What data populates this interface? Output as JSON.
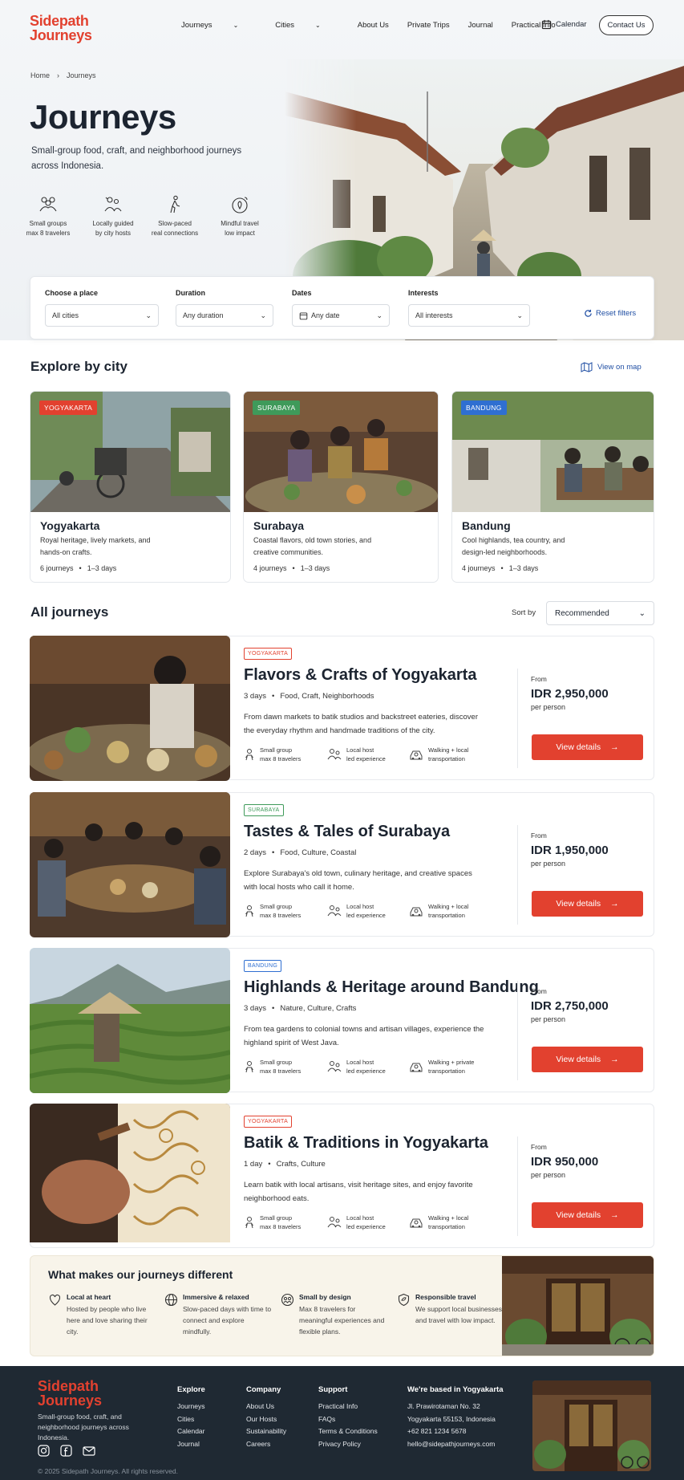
{
  "brand": {
    "name_line1": "Sidepath",
    "name_line2": "Journeys"
  },
  "nav": {
    "items": [
      {
        "label": "Journeys",
        "has_menu": true
      },
      {
        "label": "Cities",
        "has_menu": true
      },
      {
        "label": "About Us",
        "has_menu": false
      },
      {
        "label": "Private Trips",
        "has_menu": false
      },
      {
        "label": "Journal",
        "has_menu": false
      },
      {
        "label": "Practical Info",
        "has_menu": false
      }
    ],
    "calendar_label": "Calendar",
    "contact_label": "Contact Us"
  },
  "breadcrumb": {
    "home": "Home",
    "current": "Journeys"
  },
  "hero": {
    "title": "Journeys",
    "subtitle": "Small-group food, craft, and neighborhood journeys across Indonesia.",
    "features": [
      {
        "icon": "group-icon",
        "line1": "Small groups",
        "line2": "max 8 travelers"
      },
      {
        "icon": "guide-icon",
        "line1": "Locally guided",
        "line2": "by city hosts"
      },
      {
        "icon": "walker-icon",
        "line1": "Slow-paced",
        "line2": "real connections"
      },
      {
        "icon": "globe-leaf-icon",
        "line1": "Mindful travel",
        "line2": "low impact"
      }
    ]
  },
  "filters": {
    "place": {
      "label": "Choose a place",
      "value": "All cities"
    },
    "duration": {
      "label": "Duration",
      "value": "Any duration"
    },
    "dates": {
      "label": "Dates",
      "value": "Any date"
    },
    "interests": {
      "label": "Interests",
      "value": "All interests"
    },
    "reset_label": "Reset filters"
  },
  "explore": {
    "title": "Explore by city",
    "map_link": "View on map",
    "cities": [
      {
        "badge": "YOGYAKARTA",
        "badge_color": "#e2412f",
        "name": "Yogyakarta",
        "desc": "Royal heritage, lively markets, and hands-on crafts.",
        "journeys": "6 journeys",
        "days": "1–3 days"
      },
      {
        "badge": "SURABAYA",
        "badge_color": "#3f9a5a",
        "name": "Surabaya",
        "desc": "Coastal flavors, old town stories, and creative communities.",
        "journeys": "4 journeys",
        "days": "1–3 days"
      },
      {
        "badge": "BANDUNG",
        "badge_color": "#2f6fd1",
        "name": "Bandung",
        "desc": "Cool highlands, tea country, and design-led neighborhoods.",
        "journeys": "4 journeys",
        "days": "1–3 days"
      }
    ]
  },
  "all_journeys": {
    "title": "All journeys",
    "sort_label": "Sort by",
    "sort_value": "Recommended",
    "from_label": "From",
    "per_person": "per person",
    "button_label": "View details",
    "items": [
      {
        "tag": "YOGYAKARTA",
        "tag_color": "#e2412f",
        "title": "Flavors & Crafts of Yogyakarta",
        "days": "3 days",
        "themes": "Food, Craft, Neighborhoods",
        "desc": "From dawn markets to batik studios and backstreet eateries, discover the everyday rhythm and handmade traditions of the city.",
        "price": "IDR 2,950,000",
        "features": [
          [
            "Small group",
            "max 8 travelers"
          ],
          [
            "Local host",
            "led experience"
          ],
          [
            "Walking + local",
            "transportation"
          ]
        ]
      },
      {
        "tag": "SURABAYA",
        "tag_color": "#3f9a5a",
        "title": "Tastes & Tales of Surabaya",
        "days": "2 days",
        "themes": "Food, Culture, Coastal",
        "desc": "Explore Surabaya's old town, culinary heritage, and creative spaces with local hosts who call it home.",
        "price": "IDR 1,950,000",
        "features": [
          [
            "Small group",
            "max 8 travelers"
          ],
          [
            "Local host",
            "led experience"
          ],
          [
            "Walking + local",
            "transportation"
          ]
        ]
      },
      {
        "tag": "BANDUNG",
        "tag_color": "#2f6fd1",
        "title": "Highlands & Heritage around Bandung",
        "days": "3 days",
        "themes": "Nature, Culture, Crafts",
        "desc": "From tea gardens to colonial towns and artisan villages, experience the highland spirit of West Java.",
        "price": "IDR 2,750,000",
        "features": [
          [
            "Small group",
            "max 8 travelers"
          ],
          [
            "Local host",
            "led experience"
          ],
          [
            "Walking + private",
            "transportation"
          ]
        ]
      },
      {
        "tag": "YOGYAKARTA",
        "tag_color": "#e2412f",
        "title": "Batik & Traditions in Yogyakarta",
        "days": "1 day",
        "themes": "Crafts, Culture",
        "desc": "Learn batik with local artisans, visit heritage sites, and enjoy favorite neighborhood eats.",
        "price": "IDR 950,000",
        "features": [
          [
            "Small group",
            "max 8 travelers"
          ],
          [
            "Local host",
            "led experience"
          ],
          [
            "Walking + local",
            "transportation"
          ]
        ]
      }
    ]
  },
  "why": {
    "title": "What makes our journeys different",
    "items": [
      {
        "title": "Local at heart",
        "desc": "Hosted by people who live here and love sharing their city."
      },
      {
        "title": "Immersive & relaxed",
        "desc": "Slow-paced days with time to connect and explore mindfully."
      },
      {
        "title": "Small by design",
        "desc": "Max 8 travelers for meaningful experiences and flexible plans."
      },
      {
        "title": "Responsible travel",
        "desc": "We support local businesses and travel with low impact."
      }
    ]
  },
  "footer": {
    "tagline": "Small-group food, craft, and neighborhood journeys across Indonesia.",
    "explore": {
      "title": "Explore",
      "links": [
        "Journeys",
        "Cities",
        "Calendar",
        "Journal"
      ]
    },
    "company": {
      "title": "Company",
      "links": [
        "About Us",
        "Our Hosts",
        "Sustainability",
        "Careers"
      ]
    },
    "support": {
      "title": "Support",
      "links": [
        "Practical Info",
        "FAQs",
        "Terms & Conditions",
        "Privacy Policy"
      ]
    },
    "contact": {
      "title": "We're based in Yogyakarta",
      "lines": [
        "Jl. Prawirotaman No. 32",
        "Yogyakarta 55153, Indonesia",
        "+62 821 1234 5678",
        "hello@sidepathjourneys.com"
      ]
    },
    "copyright": "© 2025 Sidepath Journeys. All rights reserved."
  },
  "colors": {
    "accent": "#e2412f",
    "link": "#1f4ea3",
    "footer_bg": "#1f2933",
    "why_bg": "#f8f4ea"
  }
}
